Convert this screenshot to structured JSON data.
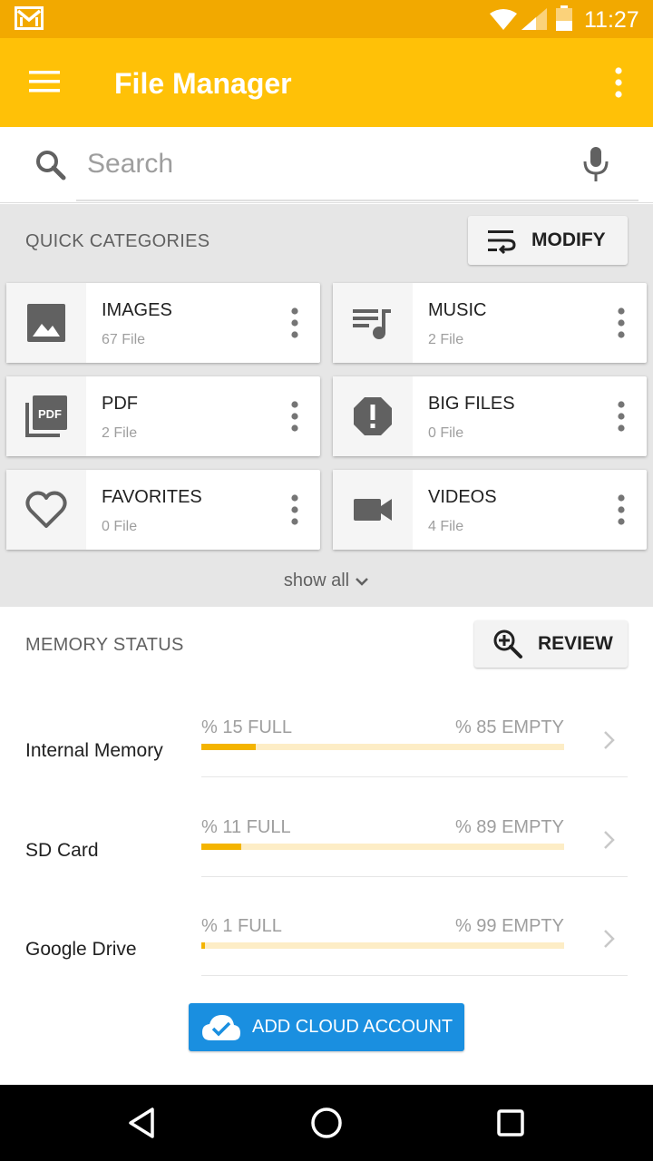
{
  "status_bar": {
    "time": "11:27",
    "icons": [
      "gmail-icon",
      "wifi-icon",
      "signal-icon",
      "battery-icon"
    ]
  },
  "app_bar": {
    "title": "File Manager",
    "icons": [
      "hamburger-menu-icon",
      "overflow-menu-icon"
    ],
    "color": "#ffc107"
  },
  "search": {
    "placeholder": "Search",
    "icons": [
      "search-icon",
      "mic-icon"
    ]
  },
  "quick_categories": {
    "label": "QUICK CATEGORIES",
    "modify_label": "MODIFY",
    "show_all_label": "show all",
    "items": [
      {
        "name": "IMAGES",
        "count": "67 File",
        "icon": "image-icon"
      },
      {
        "name": "MUSIC",
        "count": "2 File",
        "icon": "music-icon"
      },
      {
        "name": "PDF",
        "count": "2 File",
        "icon": "pdf-icon"
      },
      {
        "name": "BIG FILES",
        "count": "0 File",
        "icon": "alert-octagon-icon"
      },
      {
        "name": "FAVORITES",
        "count": "0 File",
        "icon": "heart-icon"
      },
      {
        "name": "VIDEOS",
        "count": "4 File",
        "icon": "video-camera-icon"
      }
    ]
  },
  "memory_status": {
    "label": "MEMORY STATUS",
    "review_label": "REVIEW",
    "items": [
      {
        "name": "Internal Memory",
        "full": "% 15 FULL",
        "empty": "% 85 EMPTY",
        "fraction": 0.15
      },
      {
        "name": "SD Card",
        "full": "% 11 FULL",
        "empty": "% 89 EMPTY",
        "fraction": 0.11
      },
      {
        "name": "Google Drive",
        "full": "% 1 FULL",
        "empty": "% 99 EMPTY",
        "fraction": 0.01
      }
    ],
    "add_cloud_label": "ADD CLOUD ACCOUNT",
    "bar_fill_color": "#f4b400",
    "bar_track_color": "#fdedc6",
    "cloud_button_color": "#1a8fe0"
  },
  "nav_bar": {
    "icons": [
      "back-icon",
      "home-icon",
      "recents-icon"
    ]
  }
}
